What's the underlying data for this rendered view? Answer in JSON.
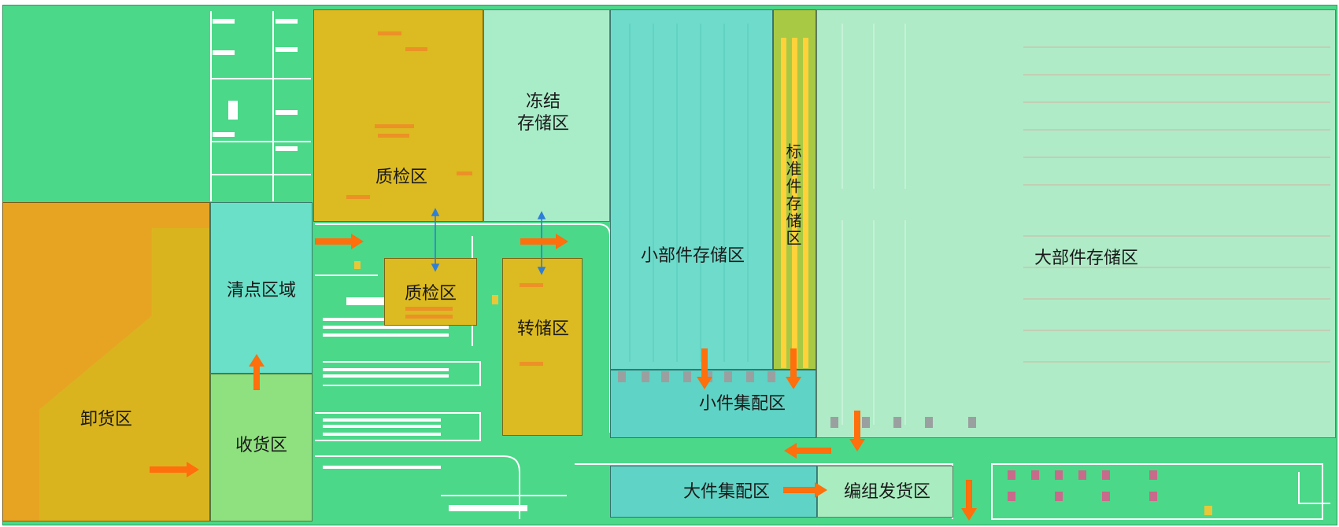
{
  "zones": {
    "unloading": "卸货区",
    "counting_area": "清点区域",
    "receiving": "收货区",
    "quality_check_top": "质检区",
    "frozen_storage": "冻结\n存储区",
    "quality_check_mid": "质检区",
    "transfer_storage": "转储区",
    "small_parts_storage": "小部件存储区",
    "standard_parts_storage": "标准件存储区",
    "large_parts_storage": "大部件存储区",
    "small_parts_assembly": "小件集配区",
    "large_parts_assembly": "大件集配区",
    "grouping_dispatch": "编组发货区"
  },
  "colors": {
    "floor": "#4bd889",
    "unloading": "#e7a423",
    "quality_zone": "#dcba21",
    "storage_light": "#aeebc6",
    "assembly": "#5fd3c5",
    "flow_arrow": "#ff6f0c",
    "transfer_arrow": "#2f7fd6"
  }
}
